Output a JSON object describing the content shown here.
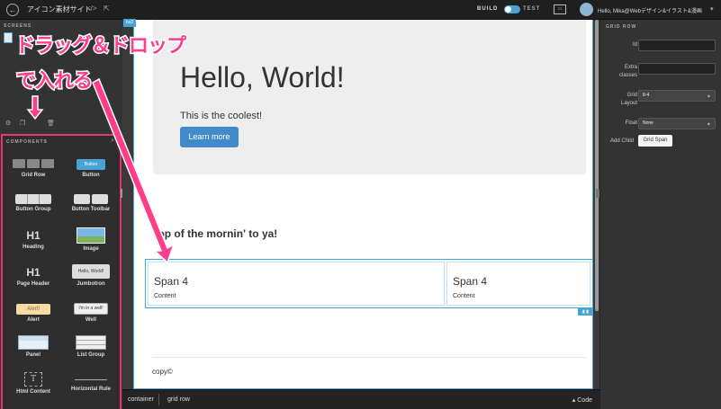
{
  "topbar": {
    "title": "アイコン素材サイト",
    "code_icon": "</>",
    "build": "BUILD",
    "test": "TEST",
    "preview_icon": "desktop-preview-icon",
    "user_greeting": "Hello, Mika@Webデザイン&イラスト&漫画",
    "user_caret": "▾"
  },
  "left": {
    "screens_header": "SCREENS",
    "components_header": "COMPONENTS",
    "components": [
      {
        "label": "Grid Row"
      },
      {
        "label": "Button",
        "preview": "Button"
      },
      {
        "label": "Button Group"
      },
      {
        "label": "Button Toolbar"
      },
      {
        "label": "Heading",
        "preview": "H1"
      },
      {
        "label": "Image"
      },
      {
        "label": "Page Header",
        "preview": "H1"
      },
      {
        "label": "Jumbotron",
        "preview": "Hello, World!"
      },
      {
        "label": "Alert",
        "preview": "Alert!"
      },
      {
        "label": "Well",
        "preview": "I'm in a well!"
      },
      {
        "label": "Panel"
      },
      {
        "label": "List Group"
      },
      {
        "label": "Html Content",
        "preview": "T"
      },
      {
        "label": "Horizontal Rule"
      }
    ]
  },
  "canvas": {
    "framework_tag": "bs3",
    "jumbotron": {
      "heading": "Hello, World!",
      "text": "This is the coolest!",
      "button": "Learn more"
    },
    "subheading": "Top of the mornin' to ya!",
    "spans": [
      {
        "title": "Span 4",
        "content": "Content"
      },
      {
        "title": "Span 4",
        "content": "Content"
      }
    ],
    "footer": "copy©"
  },
  "bottombar": {
    "crumbs": [
      "container",
      "grid row"
    ],
    "code_toggle": "▴ Code"
  },
  "right": {
    "header": "GRID ROW",
    "labels": {
      "id": "Id",
      "extra_classes": "Extra classes",
      "grid_layout": "Grid Layout",
      "float": "Float",
      "add_child": "Add Child"
    },
    "values": {
      "grid_layout": "8-4",
      "float": "None"
    },
    "add_child_button": "Grid Span"
  },
  "annotations": {
    "drag_drop": "ドラッグ＆ドロップ",
    "put_in": "で入れる",
    "color": "#ff3d8b"
  }
}
